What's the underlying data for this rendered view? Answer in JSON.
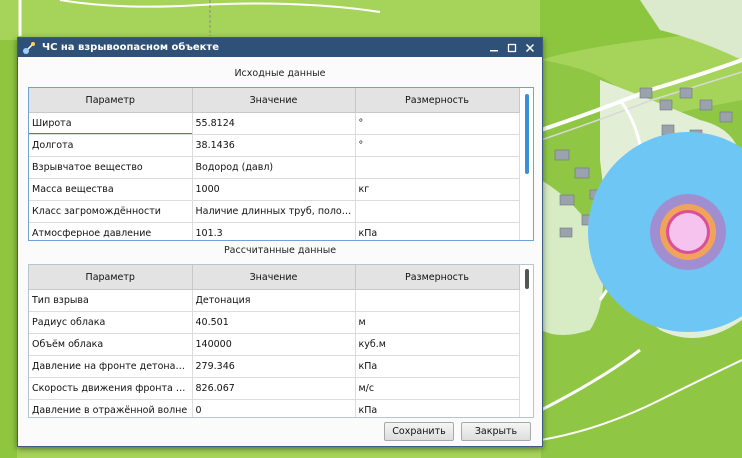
{
  "window": {
    "title": "ЧС на взрывоопасном объекте"
  },
  "input_section": {
    "title": "Исходные данные",
    "columns": [
      "Параметр",
      "Значение",
      "Размерность"
    ],
    "rows": [
      [
        "Широта",
        "55.8124",
        "°"
      ],
      [
        "Долгота",
        "38.1436",
        "°"
      ],
      [
        "Взрывчатое вещество",
        "Водород (давл)",
        ""
      ],
      [
        "Масса вещества",
        "1000",
        "кг"
      ],
      [
        "Класс загромождённости",
        "Наличие длинных труб, полостей, ...",
        ""
      ],
      [
        "Атмосферное давление",
        "101.3",
        "кПа"
      ]
    ]
  },
  "result_section": {
    "title": "Рассчитанные данные",
    "columns": [
      "Параметр",
      "Значение",
      "Размерность"
    ],
    "rows": [
      [
        "Тип взрыва",
        "Детонация",
        ""
      ],
      [
        "Радиус облака",
        "40.501",
        "м"
      ],
      [
        "Объём облака",
        "140000",
        "куб.м"
      ],
      [
        "Давление на фронте детонацион...",
        "279.346",
        "кПа"
      ],
      [
        "Скорость движения фронта детон...",
        "826.067",
        "м/с"
      ],
      [
        "Давление в отражённой волне",
        "0",
        "кПа"
      ]
    ]
  },
  "buttons": {
    "save": "Сохранить",
    "close": "Закрыть"
  },
  "colors": {
    "titlebar": "#2f5178",
    "zone_outer": "#6ec6f5",
    "zone_2": "#a08ed0",
    "zone_3": "#f1a35b",
    "zone_4": "#d8509a",
    "zone_core": "#f6c3ee"
  }
}
